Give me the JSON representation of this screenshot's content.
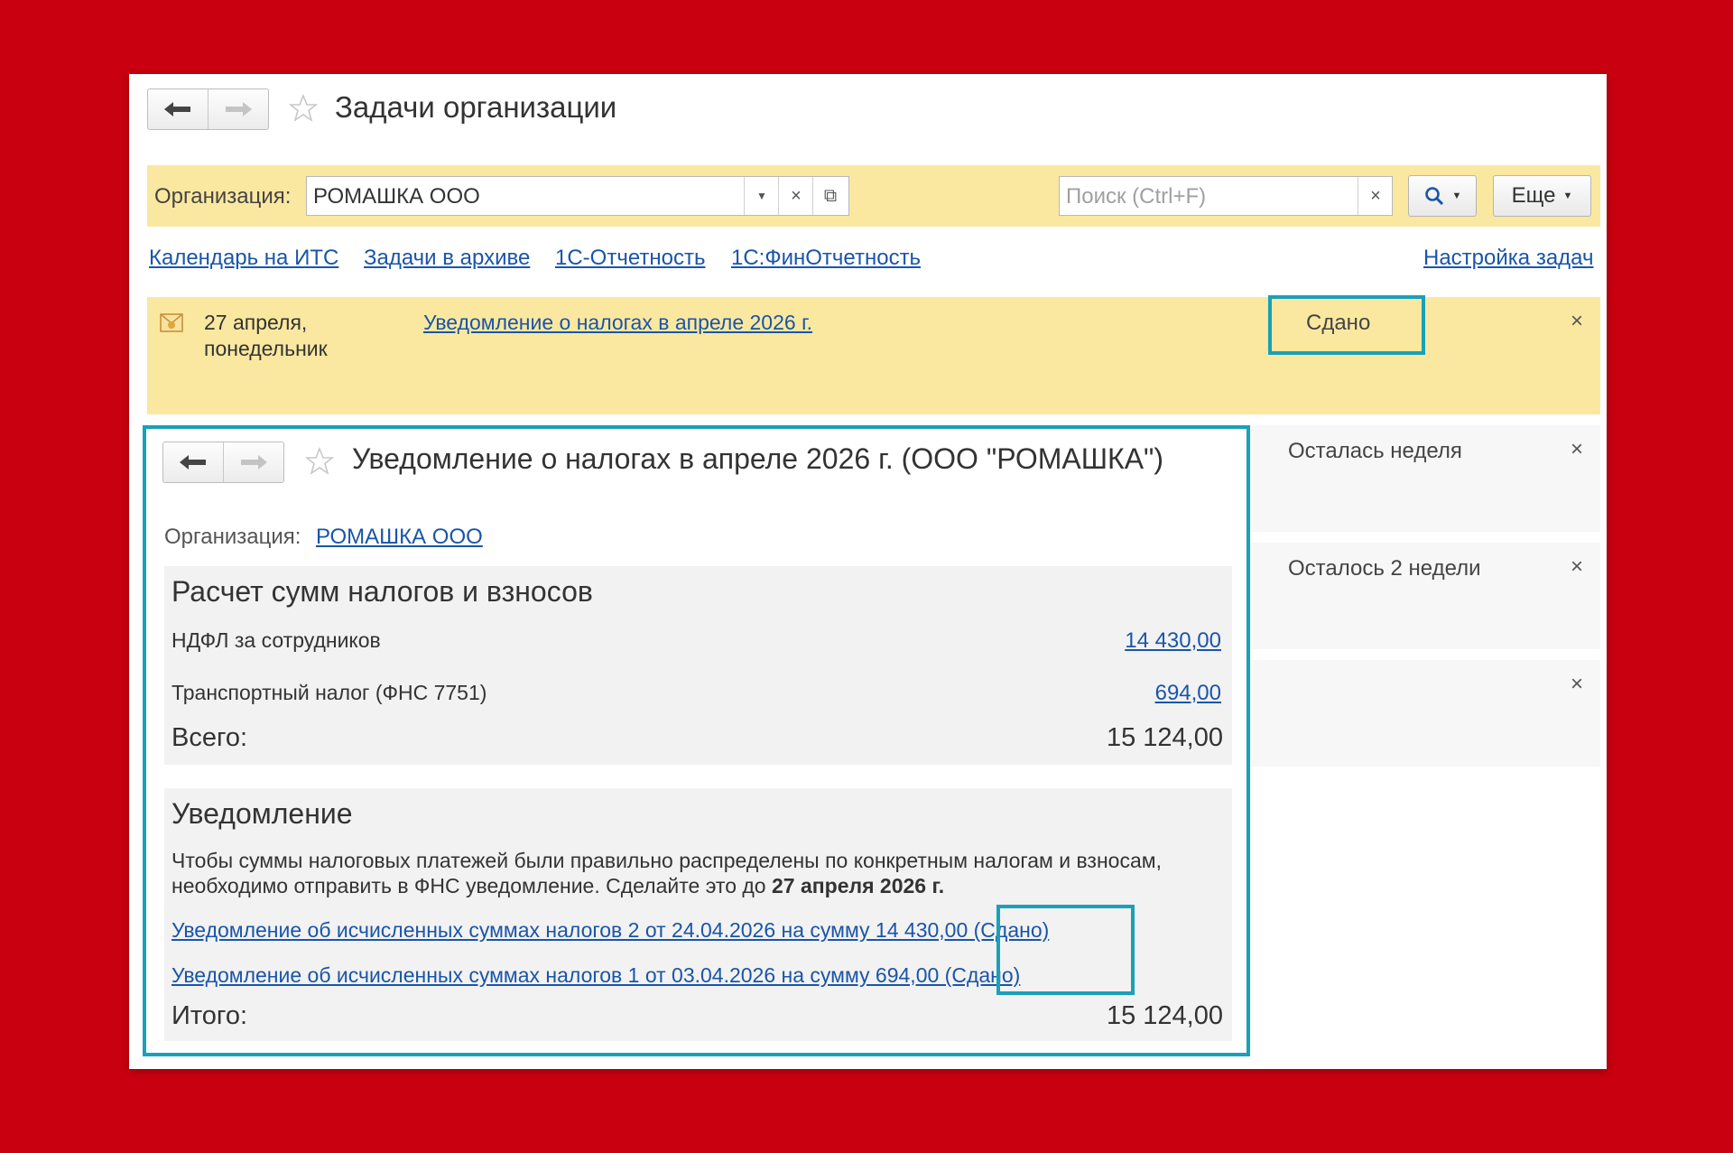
{
  "window": {
    "title": "Задачи организации"
  },
  "filter": {
    "org_label": "Организация:",
    "org_value": "РОМАШКА ООО",
    "search_placeholder": "Поиск (Ctrl+F)",
    "more_label": "Еще"
  },
  "links": {
    "calendar": "Календарь на ИТС",
    "archive": "Задачи в архиве",
    "reporting": "1С-Отчетность",
    "fin_reporting": "1С:ФинОтчетность",
    "settings": "Настройка задач"
  },
  "task": {
    "date_line1": "27 апреля,",
    "date_line2": "понедельник",
    "title": "Уведомление о налогах в апреле 2026 г.",
    "status": "Сдано"
  },
  "other_tasks": [
    {
      "status": "Осталась неделя"
    },
    {
      "status": "Осталось 2 недели"
    },
    {
      "status": ""
    }
  ],
  "detail": {
    "title": "Уведомление о налогах в апреле 2026 г. (ООО \"РОМАШКА\")",
    "org_label": "Организация:",
    "org_value": "РОМАШКА ООО",
    "calc": {
      "heading": "Расчет сумм налогов и взносов",
      "rows": [
        {
          "label": "НДФЛ за сотрудников",
          "amount": "14 430,00"
        },
        {
          "label": "Транспортный налог (ФНС 7751)",
          "amount": "694,00"
        }
      ],
      "total_label": "Всего:",
      "total_value": "15 124,00"
    },
    "notice": {
      "heading": "Уведомление",
      "text_plain": "Чтобы суммы налоговых платежей были правильно распределены по конкретным налогам и взносам, необходимо отправить в ФНС уведомление. Сделайте это до ",
      "text_bold": "27 апреля 2026 г.",
      "links": [
        "Уведомление об исчисленных суммах налогов 2 от 24.04.2026 на сумму 14 430,00 (Сдано)",
        "Уведомление об исчисленных суммах налогов 1 от 03.04.2026 на сумму 694,00 (Сдано)"
      ],
      "total_label": "Итого:",
      "total_value": "15 124,00"
    }
  },
  "colors": {
    "background": "#c8000f",
    "highlight": "#1aa0b8",
    "yellow_bar": "#fbe8a0",
    "link": "#1a55a8"
  }
}
